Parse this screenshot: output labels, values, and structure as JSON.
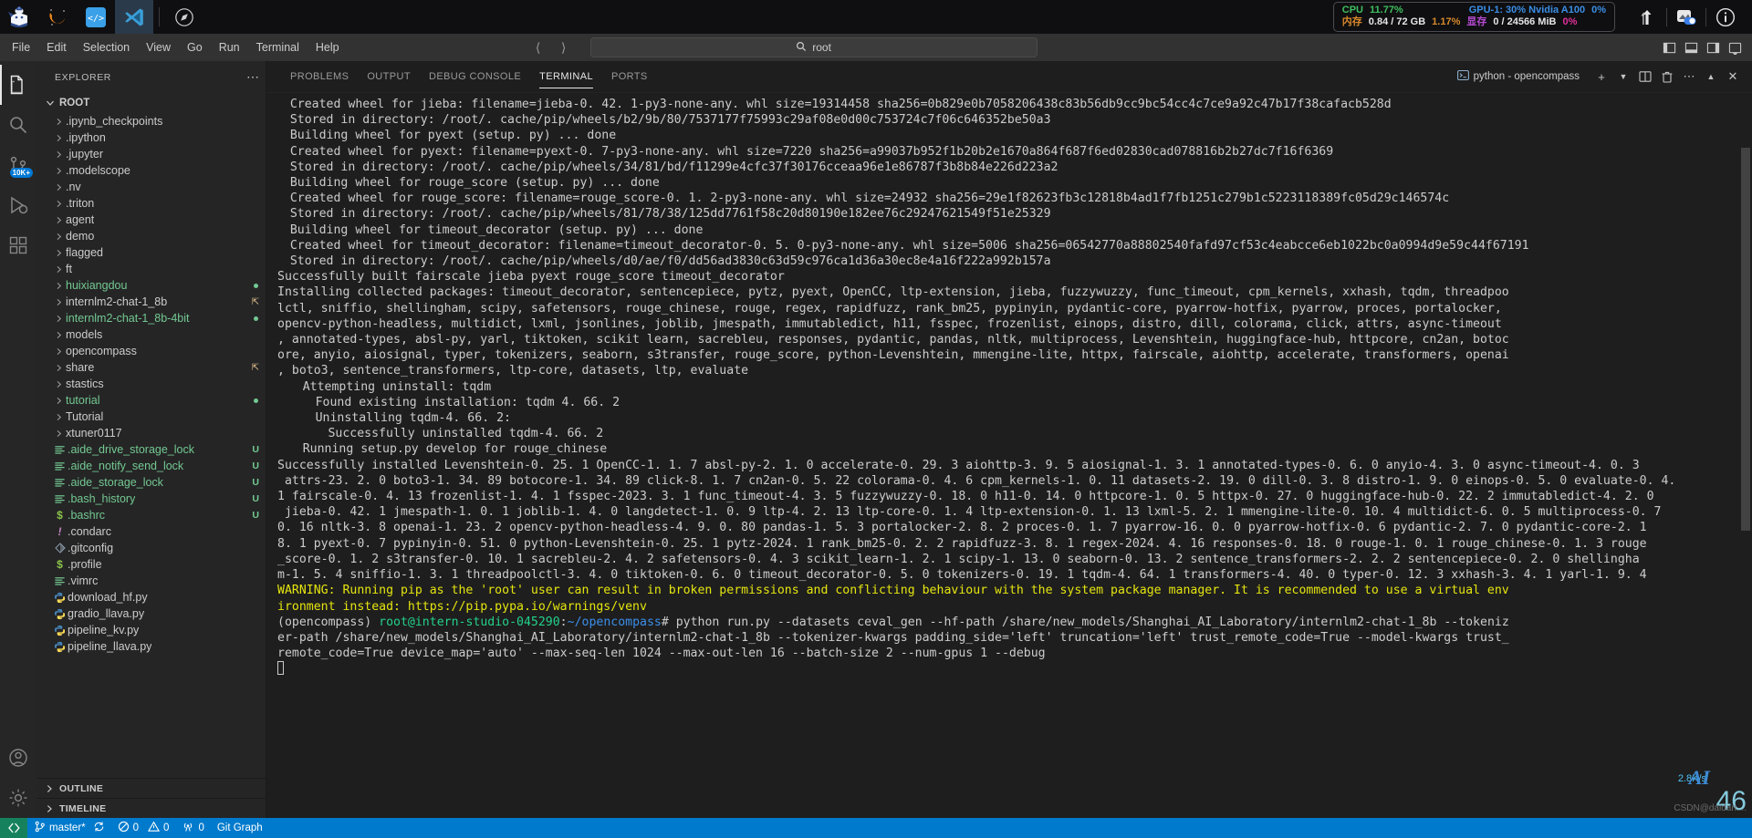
{
  "os_bar": {
    "apps": [
      {
        "name": "huixiangdou-app-icon",
        "active": false
      },
      {
        "name": "conda-app-icon",
        "active": false
      },
      {
        "name": "code-server-app-icon",
        "active": false
      },
      {
        "name": "vscode-app-icon",
        "active": true
      }
    ],
    "compass_icon": "compass-icon",
    "stats": {
      "cpu_label": "CPU",
      "cpu_value": "11.77%",
      "gpu_label": "GPU-1: 30% Nvidia A100",
      "gpu_value": "0%",
      "mem_label": "内存",
      "mem_value": "0.84 / 72 GB",
      "mem_pct": "1.17%",
      "vram_label": "显存",
      "vram_value": "0 / 24566 MiB",
      "vram_pct": "0%"
    },
    "tray": [
      "network-upload-icon",
      "remote-toggle-icon",
      "info-icon"
    ]
  },
  "menubar": {
    "items": [
      "File",
      "Edit",
      "Selection",
      "View",
      "Go",
      "Run",
      "Terminal",
      "Help"
    ],
    "back_icon": "chevron-left-icon",
    "forward_icon": "chevron-right-icon",
    "search": {
      "icon": "search-icon",
      "value": "root"
    },
    "layout_icons": [
      "toggle-primary-sidebar-icon",
      "toggle-panel-icon",
      "toggle-secondary-sidebar-icon",
      "customize-layout-icon"
    ]
  },
  "activitybar": {
    "items": [
      {
        "name": "explorer",
        "icon": "files-icon",
        "active": true,
        "badge": ""
      },
      {
        "name": "search",
        "icon": "search-icon",
        "active": false,
        "badge": ""
      },
      {
        "name": "source-control",
        "icon": "source-control-icon",
        "active": false,
        "badge": "10K+"
      },
      {
        "name": "run-and-debug",
        "icon": "debug-icon",
        "active": false,
        "badge": ""
      },
      {
        "name": "extensions",
        "icon": "extensions-icon",
        "active": false,
        "badge": ""
      }
    ],
    "bottom": [
      {
        "name": "accounts",
        "icon": "account-icon"
      },
      {
        "name": "manage",
        "icon": "gear-icon"
      }
    ]
  },
  "sidebar": {
    "title": "EXPLORER",
    "more_icon": "ellipsis-icon",
    "root_label": "ROOT",
    "tree": [
      {
        "label": ".ipynb_checkpoints",
        "type": "folder",
        "color": "normal",
        "flag": ""
      },
      {
        "label": ".ipython",
        "type": "folder",
        "color": "normal",
        "flag": ""
      },
      {
        "label": ".jupyter",
        "type": "folder",
        "color": "normal",
        "flag": ""
      },
      {
        "label": ".modelscope",
        "type": "folder",
        "color": "normal",
        "flag": ""
      },
      {
        "label": ".nv",
        "type": "folder",
        "color": "normal",
        "flag": ""
      },
      {
        "label": ".triton",
        "type": "folder",
        "color": "normal",
        "flag": ""
      },
      {
        "label": "agent",
        "type": "folder",
        "color": "normal",
        "flag": ""
      },
      {
        "label": "demo",
        "type": "folder",
        "color": "normal",
        "flag": ""
      },
      {
        "label": "flagged",
        "type": "folder",
        "color": "normal",
        "flag": ""
      },
      {
        "label": "ft",
        "type": "folder",
        "color": "normal",
        "flag": ""
      },
      {
        "label": "huixiangdou",
        "type": "folder",
        "color": "green",
        "flag": "dot"
      },
      {
        "label": "internlm2-chat-1_8b",
        "type": "folder",
        "color": "normal",
        "flag": "arrow"
      },
      {
        "label": "internlm2-chat-1_8b-4bit",
        "type": "folder",
        "color": "green",
        "flag": "dot"
      },
      {
        "label": "models",
        "type": "folder",
        "color": "normal",
        "flag": ""
      },
      {
        "label": "opencompass",
        "type": "folder",
        "color": "normal",
        "flag": ""
      },
      {
        "label": "share",
        "type": "folder",
        "color": "normal",
        "flag": "arrow"
      },
      {
        "label": "stastics",
        "type": "folder",
        "color": "normal",
        "flag": ""
      },
      {
        "label": "tutorial",
        "type": "folder",
        "color": "green",
        "flag": "dot"
      },
      {
        "label": "Tutorial",
        "type": "folder",
        "color": "normal",
        "flag": ""
      },
      {
        "label": "xtuner0117",
        "type": "folder",
        "color": "normal",
        "flag": ""
      },
      {
        "label": ".aide_drive_storage_lock",
        "type": "file",
        "icon": "text-file-icon",
        "color": "green",
        "flag": "U"
      },
      {
        "label": ".aide_notify_send_lock",
        "type": "file",
        "icon": "text-file-icon",
        "color": "green",
        "flag": "U"
      },
      {
        "label": ".aide_storage_lock",
        "type": "file",
        "icon": "text-file-icon",
        "color": "green",
        "flag": "U"
      },
      {
        "label": ".bash_history",
        "type": "file",
        "icon": "text-file-icon",
        "color": "green",
        "flag": "U"
      },
      {
        "label": ".bashrc",
        "type": "file",
        "icon": "shell-file-icon",
        "color": "green",
        "flag": "U"
      },
      {
        "label": ".condarc",
        "type": "file",
        "icon": "config-file-icon",
        "color": "normal",
        "flag": ""
      },
      {
        "label": ".gitconfig",
        "type": "file",
        "icon": "git-file-icon",
        "color": "normal",
        "flag": ""
      },
      {
        "label": ".profile",
        "type": "file",
        "icon": "shell-file-icon",
        "color": "normal",
        "flag": ""
      },
      {
        "label": ".vimrc",
        "type": "file",
        "icon": "text-file-icon",
        "color": "normal",
        "flag": ""
      },
      {
        "label": "download_hf.py",
        "type": "file",
        "icon": "python-file-icon",
        "color": "normal",
        "flag": ""
      },
      {
        "label": "gradio_llava.py",
        "type": "file",
        "icon": "python-file-icon",
        "color": "normal",
        "flag": ""
      },
      {
        "label": "pipeline_kv.py",
        "type": "file",
        "icon": "python-file-icon",
        "color": "normal",
        "flag": ""
      },
      {
        "label": "pipeline_llava.py",
        "type": "file",
        "icon": "python-file-icon",
        "color": "normal",
        "flag": ""
      }
    ],
    "sections": [
      {
        "label": "OUTLINE",
        "icon": "chevron-right-icon"
      },
      {
        "label": "TIMELINE",
        "icon": "chevron-right-icon"
      }
    ]
  },
  "panel": {
    "more_icon": "ellipsis-icon",
    "tabs": [
      {
        "label": "PROBLEMS",
        "active": false
      },
      {
        "label": "OUTPUT",
        "active": false
      },
      {
        "label": "DEBUG CONSOLE",
        "active": false
      },
      {
        "label": "TERMINAL",
        "active": true
      },
      {
        "label": "PORTS",
        "active": false
      }
    ],
    "terminal_chip": {
      "icon": "terminal-icon",
      "label": "python - opencompass"
    },
    "actions": [
      "new-terminal-icon",
      "chevron-down-icon",
      "split-terminal-icon",
      "kill-terminal-icon",
      "ellipsis-icon",
      "chevron-up-icon",
      "close-panel-icon"
    ]
  },
  "terminal": {
    "lines": [
      {
        "indent": 1,
        "text": "Created wheel for jieba: filename=jieba-0. 42. 1-py3-none-any. whl size=19314458 sha256=0b829e0b7058206438c83b56db9cc9bc54cc4c7ce9a92c47b17f38cafacb528d"
      },
      {
        "indent": 1,
        "text": "Stored in directory: /root/. cache/pip/wheels/b2/9b/80/7537177f75993c29af08e0d00c753724c7f06c646352be50a3"
      },
      {
        "indent": 1,
        "text": "Building wheel for pyext (setup. py) ... done"
      },
      {
        "indent": 1,
        "text": "Created wheel for pyext: filename=pyext-0. 7-py3-none-any. whl size=7220 sha256=a99037b952f1b20b2e1670a864f687f6ed02830cad078816b2b27dc7f16f6369"
      },
      {
        "indent": 1,
        "text": "Stored in directory: /root/. cache/pip/wheels/34/81/bd/f11299e4cfc37f30176cceaa96e1e86787f3b8b84e226d223a2"
      },
      {
        "indent": 1,
        "text": "Building wheel for rouge_score (setup. py) ... done"
      },
      {
        "indent": 1,
        "text": "Created wheel for rouge_score: filename=rouge_score-0. 1. 2-py3-none-any. whl size=24932 sha256=29e1f82623fb3c12818b4ad1f7fb1251c279b1c5223118389fc05d29c146574c"
      },
      {
        "indent": 1,
        "text": "Stored in directory: /root/. cache/pip/wheels/81/78/38/125dd7761f58c20d80190e182ee76c29247621549f51e25329"
      },
      {
        "indent": 1,
        "text": "Building wheel for timeout_decorator (setup. py) ... done"
      },
      {
        "indent": 1,
        "text": "Created wheel for timeout_decorator: filename=timeout_decorator-0. 5. 0-py3-none-any. whl size=5006 sha256=06542770a88802540fafd97cf53c4eabcce6eb1022bc0a0994d9e59c44f67191"
      },
      {
        "indent": 1,
        "text": "Stored in directory: /root/. cache/pip/wheels/d0/ae/f0/dd56ad3830c63d59c976ca1d36a30ec8e4a16f222a992b157a"
      },
      {
        "indent": 0,
        "text": "Successfully built fairscale jieba pyext rouge_score timeout_decorator"
      },
      {
        "indent": 0,
        "text": "Installing collected packages: timeout_decorator, sentencepiece, pytz, pyext, OpenCC, ltp-extension, jieba, fuzzywuzzy, func_timeout, cpm_kernels, xxhash, tqdm, threadpoo"
      },
      {
        "indent": 0,
        "text": "lctl, sniffio, shellingham, scipy, safetensors, rouge_chinese, rouge, regex, rapidfuzz, rank_bm25, pypinyin, pydantic-core, pyarrow-hotfix, pyarrow, proces, portalocker,"
      },
      {
        "indent": 0,
        "text": "opencv-python-headless, multidict, lxml, jsonlines, joblib, jmespath, immutabledict, h11, fsspec, frozenlist, einops, distro, dill, colorama, click, attrs, async-timeout"
      },
      {
        "indent": 0,
        "text": ", annotated-types, absl-py, yarl, tiktoken, scikit learn, sacrebleu, responses, pydantic, pandas, nltk, multiprocess, Levenshtein, huggingface-hub, httpcore, cn2an, botoc"
      },
      {
        "indent": 0,
        "text": "ore, anyio, aiosignal, typer, tokenizers, seaborn, s3transfer, rouge_score, python-Levenshtein, mmengine-lite, httpx, fairscale, aiohttp, accelerate, transformers, openai"
      },
      {
        "indent": 0,
        "text": ", boto3, sentence_transformers, ltp-core, datasets, ltp, evaluate"
      },
      {
        "indent": 2,
        "text": "Attempting uninstall: tqdm"
      },
      {
        "indent": 3,
        "text": "Found existing installation: tqdm 4. 66. 2"
      },
      {
        "indent": 3,
        "text": "Uninstalling tqdm-4. 66. 2:"
      },
      {
        "indent": 4,
        "text": "Successfully uninstalled tqdm-4. 66. 2"
      },
      {
        "indent": 2,
        "text": "Running setup.py develop for rouge_chinese"
      },
      {
        "indent": 0,
        "text": "Successfully installed Levenshtein-0. 25. 1 OpenCC-1. 1. 7 absl-py-2. 1. 0 accelerate-0. 29. 3 aiohttp-3. 9. 5 aiosignal-1. 3. 1 annotated-types-0. 6. 0 anyio-4. 3. 0 async-timeout-4. 0. 3"
      },
      {
        "indent": 0,
        "text": " attrs-23. 2. 0 boto3-1. 34. 89 botocore-1. 34. 89 click-8. 1. 7 cn2an-0. 5. 22 colorama-0. 4. 6 cpm_kernels-1. 0. 11 datasets-2. 19. 0 dill-0. 3. 8 distro-1. 9. 0 einops-0. 5. 0 evaluate-0. 4."
      },
      {
        "indent": 0,
        "text": "1 fairscale-0. 4. 13 frozenlist-1. 4. 1 fsspec-2023. 3. 1 func_timeout-4. 3. 5 fuzzywuzzy-0. 18. 0 h11-0. 14. 0 httpcore-1. 0. 5 httpx-0. 27. 0 huggingface-hub-0. 22. 2 immutabledict-4. 2. 0"
      },
      {
        "indent": 0,
        "text": " jieba-0. 42. 1 jmespath-1. 0. 1 joblib-1. 4. 0 langdetect-1. 0. 9 ltp-4. 2. 13 ltp-core-0. 1. 4 ltp-extension-0. 1. 13 lxml-5. 2. 1 mmengine-lite-0. 10. 4 multidict-6. 0. 5 multiprocess-0. 7"
      },
      {
        "indent": 0,
        "text": "0. 16 nltk-3. 8 openai-1. 23. 2 opencv-python-headless-4. 9. 0. 80 pandas-1. 5. 3 portalocker-2. 8. 2 proces-0. 1. 7 pyarrow-16. 0. 0 pyarrow-hotfix-0. 6 pydantic-2. 7. 0 pydantic-core-2. 1"
      },
      {
        "indent": 0,
        "text": "8. 1 pyext-0. 7 pypinyin-0. 51. 0 python-Levenshtein-0. 25. 1 pytz-2024. 1 rank_bm25-0. 2. 2 rapidfuzz-3. 8. 1 regex-2024. 4. 16 responses-0. 18. 0 rouge-1. 0. 1 rouge_chinese-0. 1. 3 rouge"
      },
      {
        "indent": 0,
        "text": "_score-0. 1. 2 s3transfer-0. 10. 1 sacrebleu-2. 4. 2 safetensors-0. 4. 3 scikit_learn-1. 2. 1 scipy-1. 13. 0 seaborn-0. 13. 2 sentence_transformers-2. 2. 2 sentencepiece-0. 2. 0 shellingha"
      },
      {
        "indent": 0,
        "text": "m-1. 5. 4 sniffio-1. 3. 1 threadpoolctl-3. 4. 0 tiktoken-0. 6. 0 timeout_decorator-0. 5. 0 tokenizers-0. 19. 1 tqdm-4. 64. 1 transformers-4. 40. 0 typer-0. 12. 3 xxhash-3. 4. 1 yarl-1. 9. 4"
      }
    ],
    "warning_lines": [
      "WARNING: Running pip as the 'root' user can result in broken permissions and conflicting behaviour with the system package manager. It is recommended to use a virtual env",
      "ironment instead: https://pip.pypa.io/warnings/venv"
    ],
    "prompt": {
      "env": "(opencompass)",
      "user_host": "root@intern-studio-045290",
      "colon": ":",
      "path": "~/opencompass",
      "hash": "#",
      "command_part1": " python run.py --datasets ceval_gen --hf-path /share/new_models/Shanghai_AI_Laboratory/internlm2-chat-1_8b --tokeniz",
      "command_part2": "er-path /share/new_models/Shanghai_AI_Laboratory/internlm2-chat-1_8b --tokenizer-kwargs padding_side='left' truncation='left' trust_remote_code=True --model-kwargs trust_",
      "command_part3": "remote_code=True device_map='auto' --max-seq-len 1024 --max-out-len 16 --batch-size 2 --num-gpus 1 --debug"
    },
    "overlay": {
      "net_speed": "2.8K/s",
      "big_number": "46",
      "ai_mark": "AI",
      "watermark": "CSDN@daidan...."
    }
  },
  "statusbar": {
    "remote_icon": "remote-explorer-icon",
    "items": [
      {
        "name": "branch",
        "icon": "git-branch-icon",
        "label": "master*"
      },
      {
        "name": "sync",
        "icon": "sync-icon",
        "label": ""
      },
      {
        "name": "errors",
        "icon": "error-icon",
        "label": "0"
      },
      {
        "name": "warnings",
        "icon": "warning-icon",
        "label": "0"
      },
      {
        "name": "radio-tower",
        "icon": "radio-tower-icon",
        "label": "0"
      },
      {
        "name": "git-graph",
        "icon": "",
        "label": "Git Graph"
      }
    ]
  }
}
